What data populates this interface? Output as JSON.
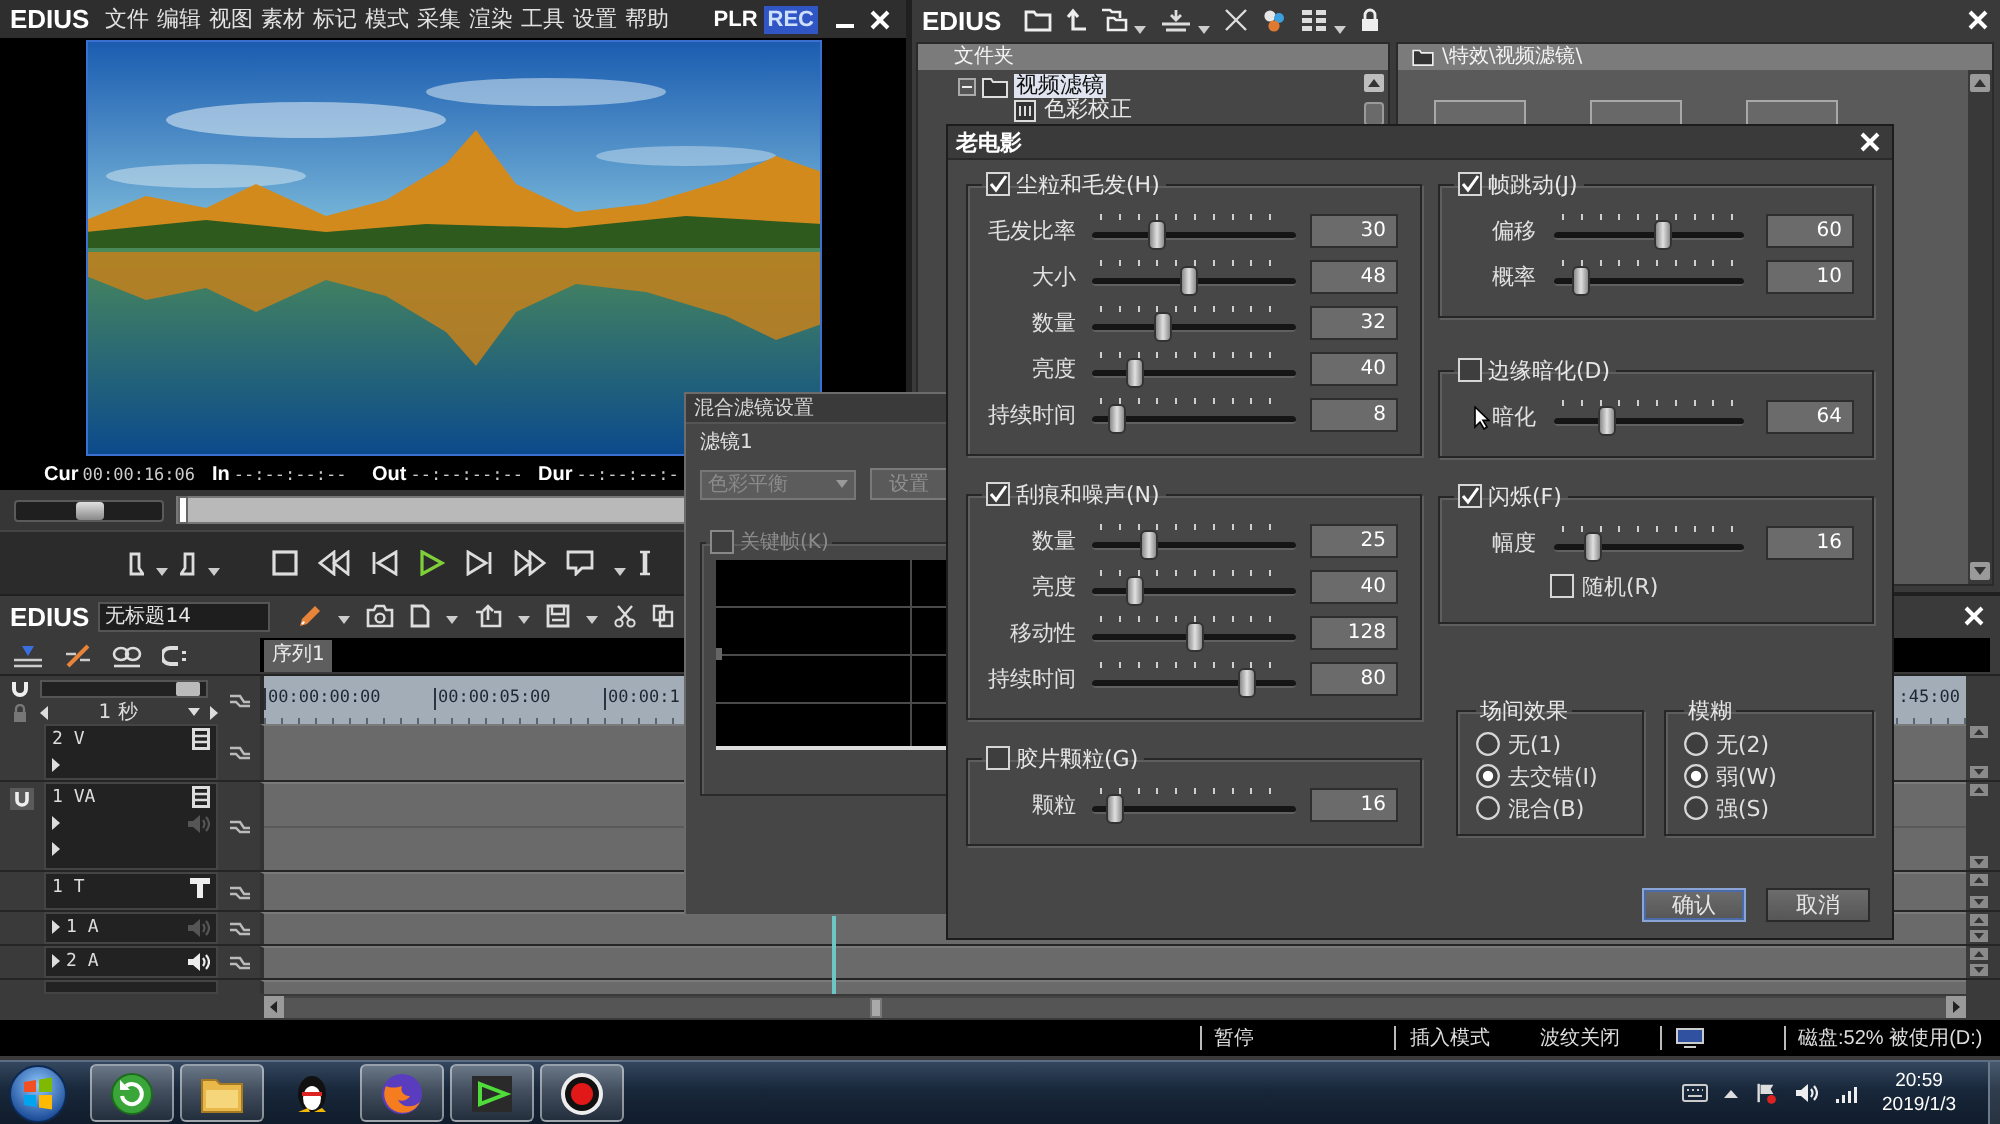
{
  "player": {
    "logo": "EDIUS",
    "menu": [
      "文件",
      "编辑",
      "视图",
      "素材",
      "标记",
      "模式",
      "采集",
      "渲染",
      "工具",
      "设置",
      "帮助"
    ],
    "modes": [
      {
        "label": "PLR",
        "selected": false
      },
      {
        "label": "REC",
        "selected": true
      }
    ],
    "timecodes": [
      {
        "label": "Cur",
        "value": "00:00:16:06"
      },
      {
        "label": "In",
        "value": "--:--:--:--"
      },
      {
        "label": "Out",
        "value": "--:--:--:--"
      },
      {
        "label": "Dur",
        "value": "--:--:--:-"
      }
    ],
    "shuttle": {
      "level": 0.5
    },
    "position": {
      "level": 0
    }
  },
  "bin": {
    "logo": "EDIUS",
    "folder_header": "文件夹",
    "tree": [
      {
        "label": "视频滤镜",
        "selected": true,
        "expanded": true,
        "children": [
          {
            "label": "色彩校正",
            "selected": false
          }
        ]
      }
    ],
    "path": "\\特效\\视频滤镜\\"
  },
  "timeline": {
    "logo": "EDIUS",
    "project_name": "无标题14",
    "sequence_tabs": [
      {
        "label": "序列1",
        "selected": true
      }
    ],
    "zoom": {
      "label": "1 秒",
      "level": 0.95
    },
    "ruler": [
      "00:00:00:00",
      "00:00:05:00",
      "00:00:1"
    ],
    "ruler_end": ":45:00",
    "tracks": [
      {
        "name": "2 V",
        "kind": "video"
      },
      {
        "name": "1 VA",
        "kind": "va",
        "muted": true
      },
      {
        "name": "1 T",
        "kind": "title"
      },
      {
        "name": "1 A",
        "kind": "audio",
        "muted": true
      },
      {
        "name": "2 A",
        "kind": "audio",
        "muted": false
      }
    ],
    "status": [
      "暂停",
      "插入模式",
      "波纹关闭",
      "磁盘:52% 被使用(D:)"
    ]
  },
  "mix_dialog": {
    "title": "混合滤镜设置",
    "filter_label": "滤镜1",
    "filter_select": {
      "value": "色彩平衡",
      "disabled": true
    },
    "settings_button": {
      "label": "设置",
      "disabled": true
    },
    "keyframe": {
      "label": "关键帧(K)",
      "checked": false,
      "disabled": true
    }
  },
  "old_film": {
    "title": "老电影",
    "left_groups": [
      {
        "label": "尘粒和毛发(H)",
        "checked": true,
        "sliders": [
          {
            "label": "毛发比率",
            "value": "30",
            "level": 0.3
          },
          {
            "label": "大小",
            "value": "48",
            "level": 0.47
          },
          {
            "label": "数量",
            "value": "32",
            "level": 0.33
          },
          {
            "label": "亮度",
            "value": "40",
            "level": 0.18
          },
          {
            "label": "持续时间",
            "value": "8",
            "level": 0.09
          }
        ]
      },
      {
        "label": "刮痕和噪声(N)",
        "checked": true,
        "sliders": [
          {
            "label": "数量",
            "value": "25",
            "level": 0.26
          },
          {
            "label": "亮度",
            "value": "40",
            "level": 0.18
          },
          {
            "label": "移动性",
            "value": "128",
            "level": 0.5
          },
          {
            "label": "持续时间",
            "value": "80",
            "level": 0.78
          }
        ]
      },
      {
        "label": "胶片颗粒(G)",
        "checked": false,
        "sliders": [
          {
            "label": "颗粒",
            "value": "16",
            "level": 0.07
          }
        ]
      }
    ],
    "right_groups": [
      {
        "label": "帧跳动(J)",
        "checked": true,
        "sliders": [
          {
            "label": "偏移",
            "value": "60",
            "level": 0.58
          },
          {
            "label": "概率",
            "value": "10",
            "level": 0.11
          }
        ]
      },
      {
        "label": "边缘暗化(D)",
        "checked": false,
        "sliders": [
          {
            "label": "暗化",
            "value": "64",
            "level": 0.26
          }
        ]
      },
      {
        "label": "闪烁(F)",
        "checked": true,
        "sliders": [
          {
            "label": "幅度",
            "value": "16",
            "level": 0.17
          }
        ],
        "options": [
          {
            "label": "随机(R)",
            "checked": false
          }
        ]
      }
    ],
    "radio_groups": [
      {
        "title": "场间效果",
        "options": [
          {
            "label": "无(1)",
            "selected": false
          },
          {
            "label": "去交错(I)",
            "selected": true
          },
          {
            "label": "混合(B)",
            "selected": false
          }
        ]
      },
      {
        "title": "模糊",
        "options": [
          {
            "label": "无(2)",
            "selected": false
          },
          {
            "label": "弱(W)",
            "selected": true
          },
          {
            "label": "强(S)",
            "selected": false
          }
        ]
      }
    ],
    "buttons": [
      {
        "label": "确认",
        "default": true
      },
      {
        "label": "取消",
        "default": false
      }
    ]
  },
  "taskbar": {
    "apps": [
      {
        "running": true
      },
      {
        "running": true
      },
      {
        "running": false
      },
      {
        "running": true
      },
      {
        "running": true
      },
      {
        "running": true
      }
    ],
    "clock": {
      "time": "20:59",
      "date": "2019/1/3"
    }
  }
}
